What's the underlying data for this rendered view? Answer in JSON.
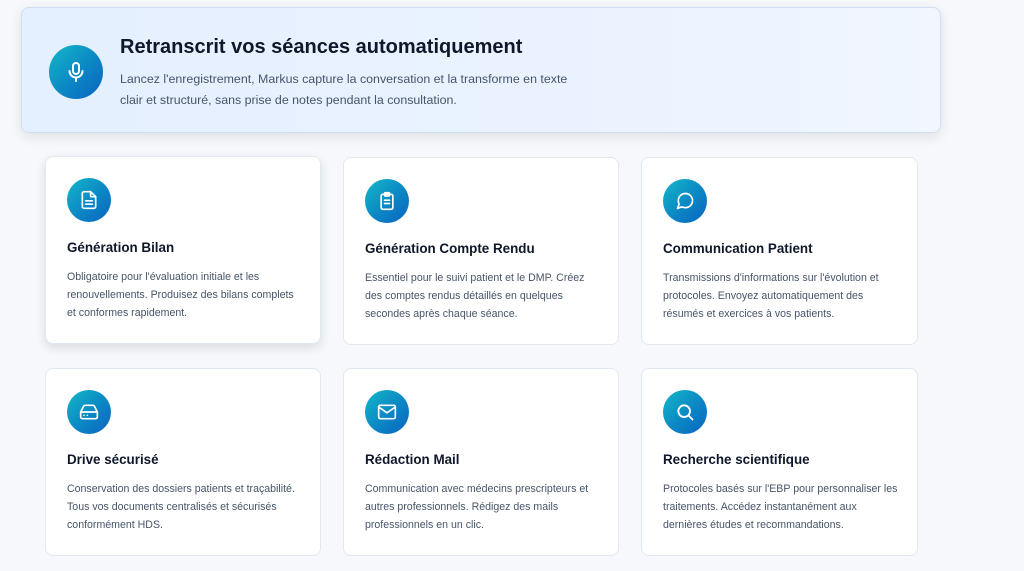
{
  "hero": {
    "icon": "microphone-icon",
    "title": "Retranscrit vos séances automatiquement",
    "description": "Lancez l'enregistrement, Markus capture la conversation et la transforme en texte clair et structuré, sans prise de notes pendant la consultation."
  },
  "features": [
    {
      "icon": "document-icon",
      "title": "Génération Bilan",
      "description": "Obligatoire pour l'évaluation initiale et les renouvellements. Produisez des bilans complets et conformes rapidement."
    },
    {
      "icon": "clipboard-icon",
      "title": "Génération Compte Rendu",
      "description": "Essentiel pour le suivi patient et le DMP. Créez des comptes rendus détaillés en quelques secondes après chaque séance."
    },
    {
      "icon": "chat-bubble-icon",
      "title": "Communication Patient",
      "description": "Transmissions d'informations sur l'évolution et protocoles. Envoyez automatiquement des résumés et exercices à vos patients."
    },
    {
      "icon": "hard-drive-icon",
      "title": "Drive sécurisé",
      "description": "Conservation des dossiers patients et traçabilité. Tous vos documents centralisés et sécurisés conformément HDS."
    },
    {
      "icon": "mail-icon",
      "title": "Rédaction Mail",
      "description": "Communication avec médecins prescripteurs et autres professionnels. Rédigez des mails professionnels en un clic."
    },
    {
      "icon": "search-icon",
      "title": "Recherche scientifique",
      "description": "Protocoles basés sur l'EBP pour personnaliser les traitements. Accédez instantanément aux dernières études et recommandations."
    }
  ],
  "colors": {
    "accent_start": "#14b8c8",
    "accent_end": "#0a64c0",
    "hero_background": "#e6f0ff",
    "page_background": "#f6f8fb"
  }
}
